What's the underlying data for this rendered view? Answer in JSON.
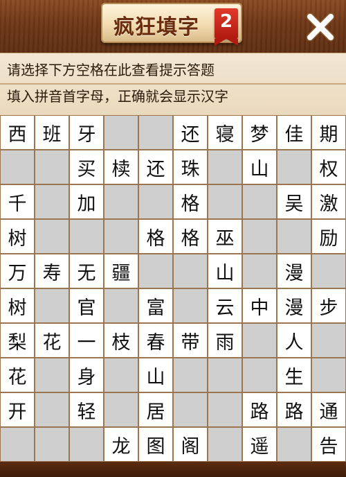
{
  "header": {
    "title": "疯狂填字",
    "badge": "2",
    "close_icon": "close-icon"
  },
  "hint_panel": {
    "line1": "请选择下方空格在此查看提示答题",
    "line2": "填入拼音首字母，正确就会显示汉字"
  },
  "grid": {
    "rows": [
      [
        "西",
        "班",
        "牙",
        "#",
        "#",
        "还",
        "寝",
        "梦",
        "佳",
        "期"
      ],
      [
        "#",
        "#",
        "买",
        "椟",
        "还",
        "珠",
        "#",
        "山",
        "#",
        "权"
      ],
      [
        "千",
        "#",
        "加",
        "#",
        "#",
        "格",
        "#",
        "#",
        "吴",
        "激"
      ],
      [
        "树",
        "#",
        "#",
        "#",
        "格",
        "格",
        "巫",
        "#",
        "#",
        "励"
      ],
      [
        "万",
        "寿",
        "无",
        "疆",
        "#",
        "#",
        "山",
        "#",
        "漫",
        "#"
      ],
      [
        "树",
        "#",
        "官",
        "#",
        "富",
        "#",
        "云",
        "中",
        "漫",
        "步"
      ],
      [
        "梨",
        "花",
        "一",
        "枝",
        "春",
        "带",
        "雨",
        "#",
        "人",
        "#"
      ],
      [
        "花",
        "#",
        "身",
        "#",
        "山",
        "#",
        "#",
        "#",
        "生",
        "#"
      ],
      [
        "开",
        "#",
        "轻",
        "#",
        "居",
        "#",
        "#",
        "路",
        "路",
        "通"
      ],
      [
        "#",
        "#",
        "#",
        "龙",
        "图",
        "阁",
        "#",
        "遥",
        "#",
        "告"
      ]
    ]
  },
  "colors": {
    "wood_dark": "#5e2e12",
    "filled_cell": "#ffffff",
    "blank_cell": "#cfcfcf",
    "badge_red": "#c8271a"
  }
}
